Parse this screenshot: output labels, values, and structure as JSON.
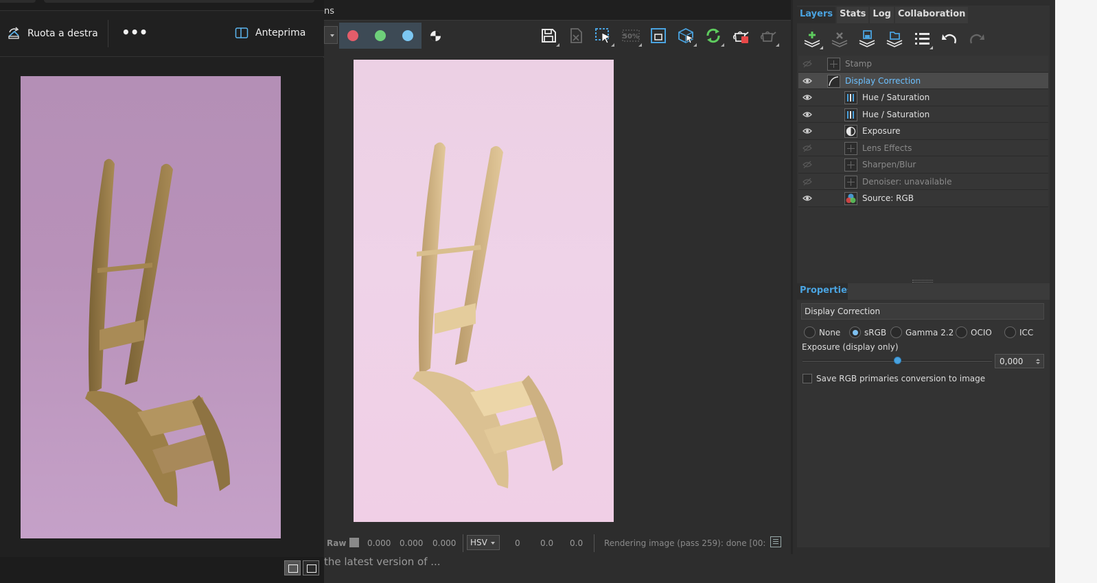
{
  "photo_viewer": {
    "rotate_label": "Ruota a destra",
    "more_label": "•••",
    "preview_label": "Anteprima"
  },
  "render_window": {
    "menu_fragment": "ns",
    "channel_colors": {
      "red": "#e35d6a",
      "green": "#6ed07a",
      "blue": "#7cc7f2"
    },
    "status": {
      "raw_label": "Raw",
      "raw_r": "0.000",
      "raw_g": "0.000",
      "raw_b": "0.000",
      "color_mode": "HSV",
      "h": "0",
      "s": "0.0",
      "v": "0.0",
      "message": "Rendering image (pass 259): done [00:"
    },
    "below_text": "the latest version of ..."
  },
  "layers_panel": {
    "tabs": [
      "Layers",
      "Stats",
      "Log",
      "Collaboration"
    ],
    "active_tab": "Layers",
    "layers": [
      {
        "name": "Stamp",
        "visible": false,
        "indent": 0,
        "icon": "stamp-icon"
      },
      {
        "name": "Display Correction",
        "visible": true,
        "indent": 0,
        "icon": "curve-icon",
        "selected": true
      },
      {
        "name": "Hue / Saturation",
        "visible": true,
        "indent": 1,
        "icon": "bars-icon"
      },
      {
        "name": "Hue / Saturation",
        "visible": true,
        "indent": 1,
        "icon": "bars-icon"
      },
      {
        "name": "Exposure",
        "visible": true,
        "indent": 1,
        "icon": "exposure-icon"
      },
      {
        "name": "Lens Effects",
        "visible": false,
        "indent": 1,
        "icon": "lens-icon"
      },
      {
        "name": "Sharpen/Blur",
        "visible": false,
        "indent": 1,
        "icon": "sharpen-icon"
      },
      {
        "name": "Denoiser: unavailable",
        "visible": false,
        "indent": 1,
        "icon": "denoise-icon"
      },
      {
        "name": "Source: RGB",
        "visible": true,
        "indent": 1,
        "icon": "rgb-source-icon"
      }
    ]
  },
  "properties": {
    "header": "Properties",
    "title": "Display Correction",
    "options": [
      "None",
      "sRGB",
      "Gamma 2.2",
      "OCIO",
      "ICC"
    ],
    "selected_option": "sRGB",
    "exposure_label": "Exposure (display only)",
    "exposure_value": "0,000",
    "exposure_slider_fraction": 0.5,
    "save_label": "Save RGB primaries conversion to image",
    "save_checked": false
  }
}
